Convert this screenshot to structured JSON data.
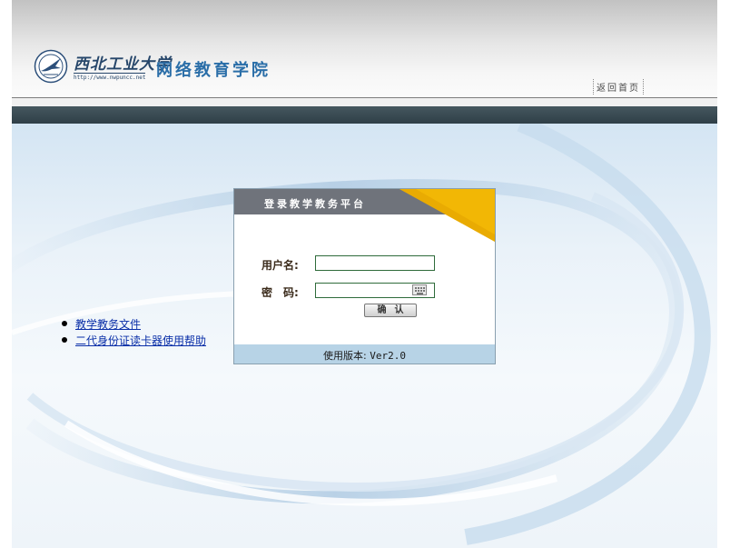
{
  "header": {
    "school_name": "西北工业大学",
    "school_url": "http://www.nwpuncc.net",
    "college_name": "网络教育学院",
    "home_link": "返回首页",
    "emblem_icon": "university-emblem-icon"
  },
  "login": {
    "title": "登录教学教务平台",
    "username_label": "用户名:",
    "password_label": "密　码:",
    "username_value": "",
    "password_value": "",
    "keyboard_icon": "virtual-keyboard-icon",
    "submit_label": "确认",
    "version_label": "使用版本:",
    "version_value": "Ver2.0"
  },
  "links": [
    {
      "label": "教学教务文件"
    },
    {
      "label": "二代身份证读卡器使用帮助"
    }
  ],
  "colors": {
    "header_band": "#34454d",
    "college_text": "#2a6ea8",
    "accent_yellow": "#f2b705",
    "login_head": "#6f737b",
    "login_foot": "#b7d3e6",
    "link": "#0a2fa8"
  }
}
